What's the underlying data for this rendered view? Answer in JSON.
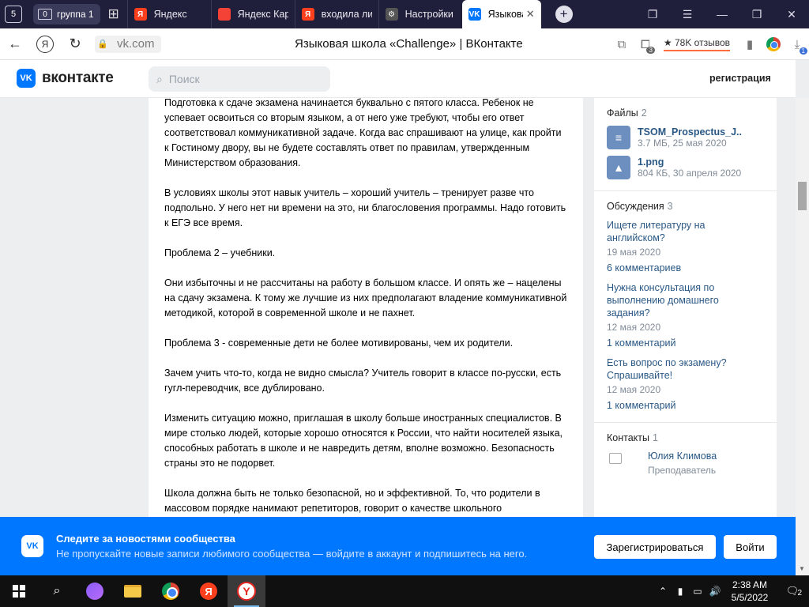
{
  "browser": {
    "group": {
      "count": "0",
      "label": "группа 1"
    },
    "tabs": [
      {
        "title": "Яндекс",
        "icon": "yandex-icon",
        "color": "#fc3f1d",
        "glyph": "Я"
      },
      {
        "title": "Яндекс Карты",
        "icon": "map-pin-icon",
        "color": "#f44336",
        "glyph": ""
      },
      {
        "title": "входила ли",
        "icon": "yandex-icon",
        "color": "#fc3f1d",
        "glyph": "Я"
      },
      {
        "title": "Настройки",
        "icon": "gear-icon",
        "color": "#555555",
        "glyph": "⚙"
      },
      {
        "title": "Языковая",
        "icon": "vk-icon",
        "color": "#0077ff",
        "glyph": "VK",
        "active": true
      }
    ],
    "address": {
      "domain": "vk.com",
      "page_title": "Языковая школа «Challenge» | ВКонтакте",
      "tabs_badge": "3",
      "reviews": "★ 78K отзывов",
      "downloads_badge": "1"
    }
  },
  "vk_header": {
    "logo_text": "вконтакте",
    "search_placeholder": "Поиск",
    "register_link": "регистрация"
  },
  "post": {
    "paragraphs": [
      "Подготовка к сдаче экзамена начинается буквально с пятого класса. Ребенок не успевает освоиться со вторым языком, а от него уже требуют, чтобы его ответ соответствовал коммуникативной задаче. Когда вас спрашивают на улице, как пройти к Гостиному двору, вы не будете составлять ответ по правилам, утвержденным Министерством образования.",
      "В условиях школы этот навык учитель – хороший учитель – тренирует разве что подпольно. У него нет ни времени на это, ни благословения программы. Надо готовить к ЕГЭ все время.",
      "Проблема 2 – учебники.",
      "Они избыточны и не рассчитаны на работу в большом классе. И опять же – нацелены на сдачу экзамена. К тому же лучшие из них предполагают владение коммуникативной методикой, которой в современной школе и не пахнет.",
      "Проблема 3 - современные дети не более мотивированы, чем их родители.",
      "Зачем учить что-то, когда не видно смысла? Учитель говорит в классе по-русски, есть гугл-переводчик, все дублировано.",
      "Изменить ситуацию можно, приглашая в школу больше иностранных специалистов. В мире столько людей, которые хорошо относятся к России, что найти носителей языка, способных работать в школе и не навредить детям, вполне возможно. Безопасность страны это не подорвет.",
      "Школа должна быть не только безопасной, но и эффективной. То, что родители в массовом порядке нанимают репетиторов, говорит о качестве школьного"
    ]
  },
  "sidebar": {
    "files": {
      "title": "Файлы",
      "count": "2",
      "items": [
        {
          "name": "TSOM_Prospectus_J..",
          "meta": "3.7 МБ, 25 мая 2020",
          "icon": "document-icon"
        },
        {
          "name": "1.png",
          "meta": "804 КБ, 30 апреля 2020",
          "icon": "image-icon"
        }
      ]
    },
    "discussions": {
      "title": "Обсуждения",
      "count": "3",
      "items": [
        {
          "title": "Ищете литературу на английском?",
          "date": "19 мая 2020",
          "comments": "6 комментариев"
        },
        {
          "title": "Нужна консультация по выполнению домашнего задания?",
          "date": "12 мая 2020",
          "comments": "1 комментарий"
        },
        {
          "title": "Есть вопрос по экзамену? Спрашивайте!",
          "date": "12 мая 2020",
          "comments": "1 комментарий"
        }
      ]
    },
    "contacts": {
      "title": "Контакты",
      "count": "1",
      "items": [
        {
          "name": "Юлия Климова",
          "role": "Преподаватель"
        }
      ]
    }
  },
  "banner": {
    "title": "Следите за новостями сообщества",
    "subtitle": "Не пропускайте новые записи любимого сообщества — войдите в аккаунт и подпишитесь на него.",
    "register_button": "Зарегистрироваться",
    "login_button": "Войти",
    "color": "#0077ff"
  },
  "taskbar": {
    "time": "2:38 AM",
    "date": "5/5/2022",
    "notifications": "2"
  }
}
